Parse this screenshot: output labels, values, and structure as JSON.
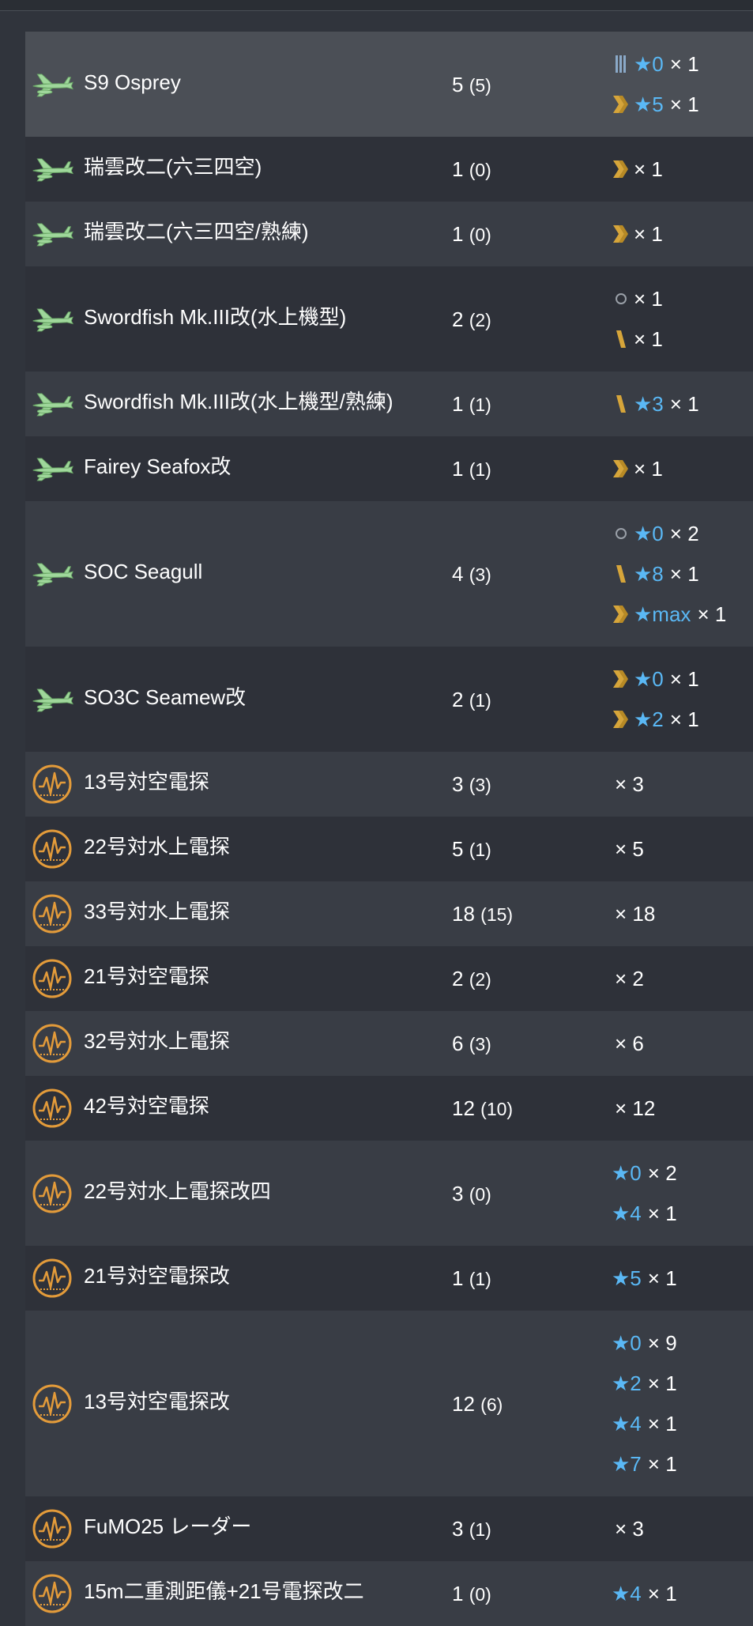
{
  "colors": {
    "background": "#30343c",
    "row_light": "#393d45",
    "row_dark": "#2e3139",
    "row_selected": "#4b4f56",
    "star": "#5ab8f5",
    "proficiency": "#d6a53a",
    "seaplane_icon": "#9fd79b",
    "radar_icon": "#e39b3a"
  },
  "rows": [
    {
      "icon": "seaplane-icon",
      "name": "S9 Osprey",
      "count": "5",
      "count_paren": "(5)",
      "details": [
        {
          "prof": "prof-bars-icon",
          "star": "★0",
          "mult": "× 1"
        },
        {
          "prof": "prof-chevron-icon",
          "star": "★5",
          "mult": "× 1"
        }
      ]
    },
    {
      "icon": "seaplane-icon",
      "name": "瑞雲改二(六三四空)",
      "count": "1",
      "count_paren": "(0)",
      "details": [
        {
          "prof": "prof-chevron-icon",
          "star": "",
          "mult": "× 1"
        }
      ]
    },
    {
      "icon": "seaplane-icon",
      "name": "瑞雲改二(六三四空/熟練)",
      "count": "1",
      "count_paren": "(0)",
      "details": [
        {
          "prof": "prof-chevron-icon",
          "star": "",
          "mult": "× 1"
        }
      ]
    },
    {
      "icon": "seaplane-icon",
      "name": "Swordfish Mk.III改(水上機型)",
      "count": "2",
      "count_paren": "(2)",
      "details": [
        {
          "prof": "prof-none-icon",
          "star": "",
          "mult": "× 1"
        },
        {
          "prof": "prof-slash-icon",
          "star": "",
          "mult": "× 1"
        }
      ]
    },
    {
      "icon": "seaplane-icon",
      "name": "Swordfish Mk.III改(水上機型/熟練)",
      "count": "1",
      "count_paren": "(1)",
      "details": [
        {
          "prof": "prof-slash-icon",
          "star": "★3",
          "mult": "× 1"
        }
      ]
    },
    {
      "icon": "seaplane-icon",
      "name": "Fairey Seafox改",
      "count": "1",
      "count_paren": "(1)",
      "details": [
        {
          "prof": "prof-chevron-icon",
          "star": "",
          "mult": "× 1"
        }
      ]
    },
    {
      "icon": "seaplane-icon",
      "name": "SOC Seagull",
      "count": "4",
      "count_paren": "(3)",
      "details": [
        {
          "prof": "prof-none-icon",
          "star": "★0",
          "mult": "× 2"
        },
        {
          "prof": "prof-slash-icon",
          "star": "★8",
          "mult": "× 1"
        },
        {
          "prof": "prof-chevron-icon",
          "star": "★max",
          "mult": "× 1"
        }
      ]
    },
    {
      "icon": "seaplane-icon",
      "name": "SO3C Seamew改",
      "count": "2",
      "count_paren": "(1)",
      "details": [
        {
          "prof": "prof-chevron-icon",
          "star": "★0",
          "mult": "× 1"
        },
        {
          "prof": "prof-chevron-icon",
          "star": "★2",
          "mult": "× 1"
        }
      ]
    },
    {
      "icon": "radar-icon",
      "name": "13号対空電探",
      "count": "3",
      "count_paren": "(3)",
      "details": [
        {
          "prof": "",
          "star": "",
          "mult": "× 3"
        }
      ]
    },
    {
      "icon": "radar-icon",
      "name": "22号対水上電探",
      "count": "5",
      "count_paren": "(1)",
      "details": [
        {
          "prof": "",
          "star": "",
          "mult": "× 5"
        }
      ]
    },
    {
      "icon": "radar-icon",
      "name": "33号対水上電探",
      "count": "18",
      "count_paren": "(15)",
      "details": [
        {
          "prof": "",
          "star": "",
          "mult": "× 18"
        }
      ]
    },
    {
      "icon": "radar-icon",
      "name": "21号対空電探",
      "count": "2",
      "count_paren": "(2)",
      "details": [
        {
          "prof": "",
          "star": "",
          "mult": "× 2"
        }
      ]
    },
    {
      "icon": "radar-icon",
      "name": "32号対水上電探",
      "count": "6",
      "count_paren": "(3)",
      "details": [
        {
          "prof": "",
          "star": "",
          "mult": "× 6"
        }
      ]
    },
    {
      "icon": "radar-icon",
      "name": "42号対空電探",
      "count": "12",
      "count_paren": "(10)",
      "details": [
        {
          "prof": "",
          "star": "",
          "mult": "× 12"
        }
      ]
    },
    {
      "icon": "radar-icon",
      "name": "22号対水上電探改四",
      "count": "3",
      "count_paren": "(0)",
      "details": [
        {
          "prof": "",
          "star": "★0",
          "mult": "× 2"
        },
        {
          "prof": "",
          "star": "★4",
          "mult": "× 1"
        }
      ]
    },
    {
      "icon": "radar-icon",
      "name": "21号対空電探改",
      "count": "1",
      "count_paren": "(1)",
      "details": [
        {
          "prof": "",
          "star": "★5",
          "mult": "× 1"
        }
      ]
    },
    {
      "icon": "radar-icon",
      "name": "13号対空電探改",
      "count": "12",
      "count_paren": "(6)",
      "details": [
        {
          "prof": "",
          "star": "★0",
          "mult": "× 9"
        },
        {
          "prof": "",
          "star": "★2",
          "mult": "× 1"
        },
        {
          "prof": "",
          "star": "★4",
          "mult": "× 1"
        },
        {
          "prof": "",
          "star": "★7",
          "mult": "× 1"
        }
      ]
    },
    {
      "icon": "radar-icon",
      "name": "FuMO25 レーダー",
      "count": "3",
      "count_paren": "(1)",
      "details": [
        {
          "prof": "",
          "star": "",
          "mult": "× 3"
        }
      ]
    },
    {
      "icon": "radar-icon",
      "name": "15m二重測距儀+21号電探改二",
      "count": "1",
      "count_paren": "(0)",
      "details": [
        {
          "prof": "",
          "star": "★4",
          "mult": "× 1"
        }
      ]
    }
  ]
}
